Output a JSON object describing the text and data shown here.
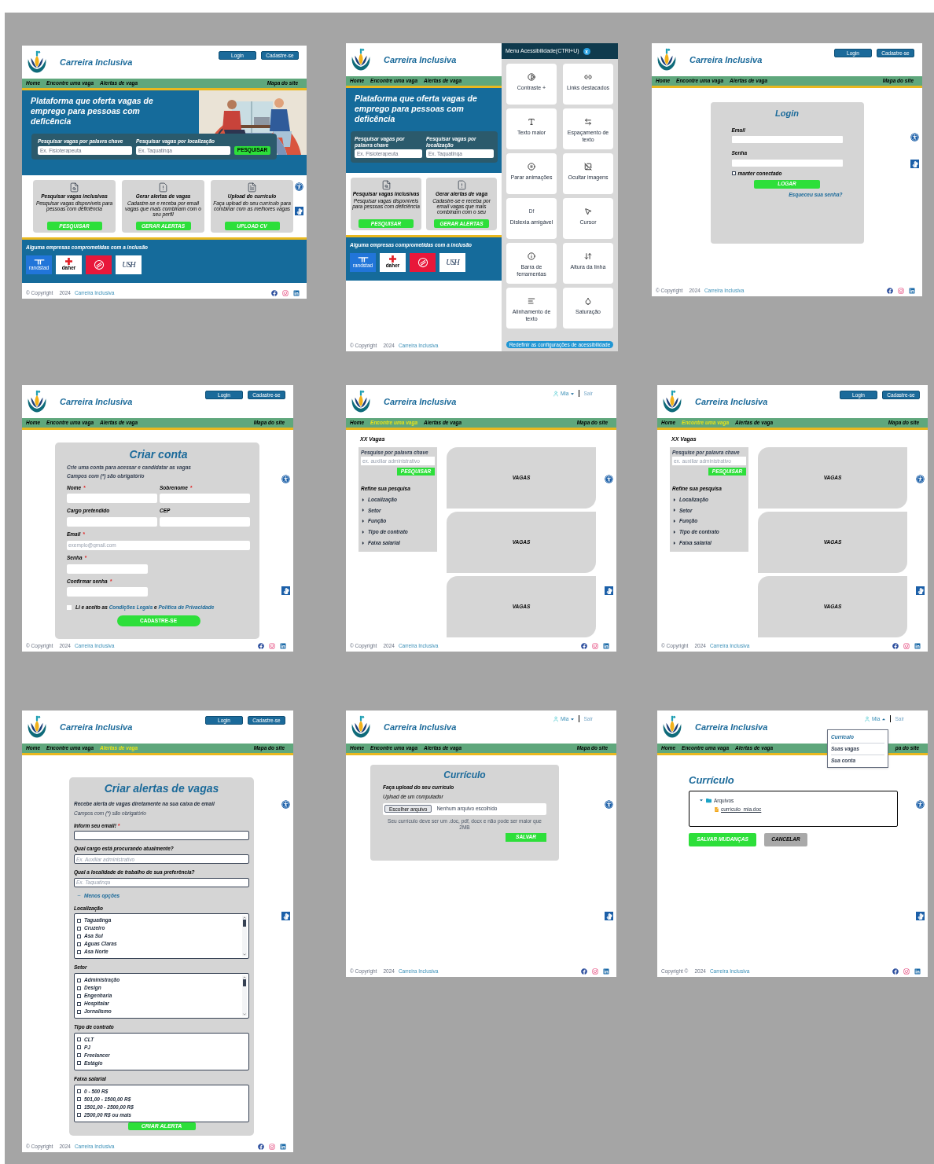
{
  "frames": [
    {
      "kind": "home",
      "header": {
        "title": "Carreira Inclusiva",
        "buttons": [
          "Login",
          "Cadastre-se"
        ]
      },
      "nav": {
        "items": [
          {
            "label": "Home",
            "selected": false
          },
          {
            "label": "Encontre uma vaga",
            "selected": false
          },
          {
            "label": "Alertas de vaga",
            "selected": false
          }
        ],
        "site_map": "Mapa do site"
      },
      "hero": {
        "title": "Plataforma que oferta vagas de emprego para pessoas com deficência",
        "picture": true,
        "search": {
          "fields": [
            {
              "label": "Pesquisar vagas por palavra chave",
              "placeholder": "Ex. Fisioterapeuta"
            },
            {
              "label": "Pesquisar vagas por localização",
              "placeholder": "Ex. Taguatinga"
            }
          ],
          "button": "PESQUISAR"
        }
      },
      "cards": [
        {
          "kind": "search",
          "title": "Pesquisar vagas inclusivas",
          "text": "Pesquisar vagas disponíveis para pessoas com deficiência",
          "button": "PESQUISAR"
        },
        {
          "kind": "alerts",
          "title": "Gerar alertas de vagas",
          "text": "Cadastre-se e receba por email vagas que mais combinam com o seu perfil",
          "button": "GERAR ALERTAS"
        },
        {
          "kind": "upload",
          "title": "Upload do currículo",
          "text": "Faça upload do seu currículo para combinar com as melhores vagas",
          "button": "UPLOAD CV"
        }
      ],
      "partners": {
        "title": "Alguma empresas comprometidas com a inclusão",
        "logos": [
          {
            "kind": "randstad",
            "label": "randstad"
          },
          {
            "kind": "daher",
            "label": "daher"
          },
          {
            "kind": "e-mark"
          },
          {
            "kind": "monogram",
            "label": "USH"
          }
        ]
      },
      "side_widgets": true,
      "footer": {
        "copyright": "© Copyright",
        "year": "2024",
        "brand": "Carreira Inclusiva",
        "socials": true
      }
    },
    {
      "kind": "home",
      "header": {
        "title": "Carreira Inclusiva"
      },
      "nav": {
        "items": [
          {
            "label": "Home",
            "selected": false
          },
          {
            "label": "Encontre uma vaga",
            "selected": false
          },
          {
            "label": "Alertas de vaga",
            "selected": false
          }
        ]
      },
      "hero": {
        "title": "Plataforma que oferta vagas de emprego para pessoas com deficência",
        "search": {
          "fields": [
            {
              "label": "Pesquisar vagas por palavra chave",
              "placeholder": "Ex. Fisioterapeuta"
            },
            {
              "label": "Pesquisar vagas por localização",
              "placeholder": "Ex. Taguatinga"
            }
          ]
        }
      },
      "cards": [
        {
          "kind": "search",
          "title": "Pesquisar vagas inclusivas",
          "text": "Pesquisar vagas disponíveis para pessoas com deficiência",
          "button": "PESQUISAR"
        },
        {
          "kind": "alerts",
          "title": "Gerar alertas de vaga",
          "text": "Cadastre-se e receba por email vagas que mais combinam com o seu",
          "button": "GERAR ALERTAS"
        }
      ],
      "partners": {
        "title": "Alguma empresas comprometidas com a inclusão",
        "logos": [
          {
            "kind": "randstad",
            "label": "randstad"
          },
          {
            "kind": "daher",
            "label": "daher"
          },
          {
            "kind": "e-mark"
          },
          {
            "kind": "monogram",
            "label": "USH"
          }
        ]
      },
      "accessibility_menu": {
        "title": "Menu Acessibilidade(CTRl+U)",
        "close": "x",
        "options": [
          {
            "kind": "contrast",
            "label": "Contraste +"
          },
          {
            "kind": "links",
            "label": "Links destacados"
          },
          {
            "kind": "text-size",
            "label": "Texto maior"
          },
          {
            "kind": "spacing",
            "label": "Espaçamento de texto"
          },
          {
            "kind": "animations",
            "label": "Parar animações"
          },
          {
            "kind": "images",
            "label": "Ocultar imagens"
          },
          {
            "kind": "dyslexia",
            "glyph": "Df",
            "label": "Dislexia amigável"
          },
          {
            "kind": "cursor",
            "label": "Cursor"
          },
          {
            "kind": "toolbar",
            "label": "Barra de ferramentas"
          },
          {
            "kind": "line-height",
            "label": "Altura da linha"
          },
          {
            "kind": "align",
            "label": "Alinhamento de texto"
          },
          {
            "kind": "saturation",
            "label": "Saturação"
          }
        ],
        "reset": "Redefinir as configurações de acessibilidade"
      },
      "footer": {
        "copyright": "© Copyright",
        "year": "2024",
        "brand": "Carreira Inclusiva"
      }
    },
    {
      "kind": "login",
      "header": {
        "title": "Carreira Inclusiva",
        "buttons": [
          "Login",
          "Cadastre-se"
        ]
      },
      "nav": {
        "items": [
          {
            "label": "Home",
            "selected": false
          },
          {
            "label": "Encontre uma vaga",
            "selected": false
          },
          {
            "label": "Alertas de vaga",
            "selected": false
          }
        ],
        "site_map": "Mapa do site"
      },
      "card": {
        "title": "Login",
        "fields": [
          {
            "label": "Email"
          },
          {
            "label": "Senha"
          }
        ],
        "remember": {
          "label": "manter conectado",
          "checked": false
        },
        "button": "LOGAR",
        "forgot": "Esqueceu sua senha?"
      },
      "side_widgets": true,
      "footer": {
        "copyright": "© Copyright",
        "year": "2024",
        "brand": "Carreira Inclusiva",
        "socials": true
      }
    },
    {
      "kind": "signup",
      "header": {
        "title": "Carreira Inclusiva",
        "buttons": [
          "Login",
          "Cadastre-se"
        ]
      },
      "nav": {
        "items": [
          {
            "label": "Home",
            "selected": false
          },
          {
            "label": "Encontre uma vaga",
            "selected": false
          },
          {
            "label": "Alertas de vaga",
            "selected": false
          }
        ],
        "site_map": "Mapa do site"
      },
      "form": {
        "title": "Criar conta",
        "subtitle": "Crie uma conta para acessar e candidatar as vagas",
        "note": "Campos com (*) são obrigatório",
        "rows": [
          [
            {
              "kind": "text",
              "label": "Nome",
              "mark": "*"
            },
            {
              "kind": "text",
              "label": "Sobrenome",
              "mark": "*"
            }
          ],
          [
            {
              "kind": "text",
              "label": "Cargo pretendido"
            },
            {
              "kind": "text",
              "label": "CEP"
            }
          ],
          [
            {
              "kind": "email",
              "label": "Email",
              "mark": "*",
              "placeholder": "exemplo@gmail.com"
            }
          ],
          [
            {
              "kind": "password",
              "label": "Senha",
              "mark": "*"
            }
          ],
          [
            {
              "kind": "password",
              "label": "Confirmar senha",
              "mark": "*"
            }
          ]
        ],
        "terms": {
          "checked": false,
          "text": "Li e aceito as",
          "links": [
            "Condições Legais",
            "Política de Privacidade"
          ],
          "joiner": "e"
        },
        "button": "CADASTRE-SE"
      },
      "side_widgets": true,
      "footer": {
        "copyright": "© Copyright",
        "year": "2024",
        "brand": "Carreira Inclusiva",
        "socials": true
      }
    },
    {
      "kind": "jobs",
      "header": {
        "title": "Carreira Inclusiva",
        "user": {
          "name": "Mia",
          "menu_open": false
        },
        "logout": "Sair"
      },
      "nav": {
        "items": [
          {
            "label": "Home",
            "selected": false
          },
          {
            "label": "Encontre uma vaga",
            "selected": true
          },
          {
            "label": "Alertas de vaga",
            "selected": false
          }
        ],
        "site_map": "Mapa do site"
      },
      "count_title": "XX Vagas",
      "search": {
        "label": "Pesquise por palavra chave",
        "placeholder": "ex. auxiliar administrativo",
        "button": "PESQUISAR"
      },
      "refine": {
        "title": "Refine sua pesquisa",
        "filters": [
          {
            "label": "Localização",
            "expanded": false
          },
          {
            "label": "Setor",
            "expanded": false
          },
          {
            "label": "Função",
            "expanded": false
          },
          {
            "label": "Tipo de contrato",
            "expanded": false
          },
          {
            "label": "Faixa salarial",
            "expanded": false
          }
        ]
      },
      "results": [
        "VAGAS",
        "VAGAS",
        "VAGAS"
      ],
      "side_widgets": true,
      "footer": {
        "copyright": "© Copyright",
        "year": "2024",
        "brand": "Carreira Inclusiva",
        "socials": true
      }
    },
    {
      "kind": "jobs",
      "header": {
        "title": "Carreira Inclusiva",
        "buttons": [
          "Login",
          "Cadastre-se"
        ]
      },
      "nav": {
        "items": [
          {
            "label": "Home",
            "selected": false
          },
          {
            "label": "Encontre uma vaga",
            "selected": true
          },
          {
            "label": "Alertas de vaga",
            "selected": false
          }
        ],
        "site_map": "Mapa do site"
      },
      "count_title": "XX Vagas",
      "search": {
        "label": "Pesquise por palavra chave",
        "placeholder": "ex. auxiliar administrativo",
        "button": "PESQUISAR"
      },
      "refine": {
        "title": "Refine sua pesquisa",
        "filters": [
          {
            "label": "Localização",
            "expanded": false
          },
          {
            "label": "Setor",
            "expanded": false
          },
          {
            "label": "Função",
            "expanded": false
          },
          {
            "label": "Tipo de contrato",
            "expanded": false
          },
          {
            "label": "Faixa salarial",
            "expanded": false
          }
        ]
      },
      "results": [
        "VAGAS",
        "VAGAS",
        "VAGAS"
      ],
      "side_widgets": true,
      "footer": {
        "copyright": "© Copyright",
        "year": "2024",
        "brand": "Carreira Inclusiva",
        "socials": true
      }
    },
    {
      "kind": "alerts",
      "header": {
        "title": "Carreira Inclusiva",
        "buttons": [
          "Login",
          "Cadastre-se"
        ]
      },
      "nav": {
        "items": [
          {
            "label": "Home",
            "selected": false
          },
          {
            "label": "Encontre uma vaga",
            "selected": false
          },
          {
            "label": "Alertas de vaga",
            "selected": true
          }
        ],
        "site_map": "Mapa do site"
      },
      "title": "Criar alertas de vagas",
      "subtitle": "Recebe alerta de vagas diretamente na sua caixa de email",
      "note": "Campos com (*) são obrigatório",
      "questions": [
        {
          "label": "Inform seu email!",
          "mark": "*"
        },
        {
          "label": "Qual cargo está procurando atualmente?",
          "placeholder": "Ex. Auxiliar administrativo"
        },
        {
          "label": "Qual a localidade de trabalho de sua preferência?",
          "placeholder": "Ex. Taguatinga"
        }
      ],
      "toggle": "Menos opções",
      "groups": [
        {
          "title": "Localização",
          "scroll": true,
          "options": [
            {
              "label": "Taguatinga",
              "checked": false
            },
            {
              "label": "Cruzeiro",
              "checked": false
            },
            {
              "label": "Asa Sul",
              "checked": false
            },
            {
              "label": "Aguas Claras",
              "checked": false
            },
            {
              "label": "Asa Norte",
              "checked": false
            }
          ]
        },
        {
          "title": "Setor",
          "scroll": true,
          "options": [
            {
              "label": "Administração",
              "checked": false
            },
            {
              "label": "Design",
              "checked": false
            },
            {
              "label": "Engenharia",
              "checked": false
            },
            {
              "label": "Hospitalar",
              "checked": false
            },
            {
              "label": "Jornalismo",
              "checked": false
            }
          ]
        },
        {
          "title": "Tipo de contrato",
          "scroll": false,
          "options": [
            {
              "label": "CLT",
              "checked": false
            },
            {
              "label": "PJ",
              "checked": false
            },
            {
              "label": "Freelancer",
              "checked": false
            },
            {
              "label": "Estágio",
              "checked": false
            }
          ]
        },
        {
          "title": "Faixa salarial",
          "scroll": false,
          "options": [
            {
              "label": "0 - 500 R$",
              "checked": false
            },
            {
              "label": "501,00 - 1500,00 R$",
              "checked": false
            },
            {
              "label": "1501,00 - 2500,00 R$",
              "checked": false
            },
            {
              "label": "2500,00 R$ ou mais",
              "checked": false
            }
          ]
        }
      ],
      "button": "CRIAR ALERTA",
      "side_widgets": true,
      "footer": {
        "copyright": "© Copyright",
        "year": "2024",
        "brand": "Carreira Inclusiva",
        "socials": true
      }
    },
    {
      "kind": "upload",
      "header": {
        "title": "Carreira Inclusiva",
        "user": {
          "name": "Mia",
          "menu_open": false
        },
        "logout": "Sair"
      },
      "nav": {
        "items": [
          {
            "label": "Home",
            "selected": false
          },
          {
            "label": "Encontre uma vaga",
            "selected": false
          },
          {
            "label": "Alertas de vaga",
            "selected": false
          }
        ],
        "site_map": "Mapa do site"
      },
      "title": "Currículo",
      "subtitle": "Faça upload do seu currículo",
      "source": "Upload de um computador",
      "file": {
        "button": "Escolher arquivo",
        "status": "Nenhum arquivo escolhido"
      },
      "hint": "Seu currículo deve ser um .doc, pdf, docx e não pode ser maior que 2MB",
      "button": "SALVAR",
      "side_widgets": true,
      "footer": {
        "copyright": "© Copyright",
        "year": "2024",
        "brand": "Carreira Inclusiva",
        "socials": true
      }
    },
    {
      "kind": "resume",
      "header": {
        "title": "Carreira Inclusiva",
        "user": {
          "name": "Mia",
          "menu_open": true,
          "menu": [
            {
              "label": "Currículo",
              "selected": true
            },
            {
              "label": "Suas vagas",
              "selected": false
            },
            {
              "label": "Sua conta",
              "selected": false
            }
          ]
        },
        "logout": "Sair"
      },
      "nav": {
        "items": [
          {
            "label": "Home",
            "selected": false
          },
          {
            "label": "Encontre uma vaga",
            "selected": false
          },
          {
            "label": "Alertas de vaga",
            "selected": false
          }
        ],
        "site_map": "pa do site"
      },
      "title": "Currículo",
      "tree": [
        {
          "label": "Arquivos",
          "expanded": true,
          "children": [
            {
              "label": "currículo_mia.doc"
            }
          ]
        }
      ],
      "actions": [
        {
          "kind": "primary",
          "label": "SALVAR MUDANÇAS"
        },
        {
          "kind": "secondary",
          "label": "CANCELAR"
        }
      ],
      "side_widgets": true,
      "footer": {
        "copyright": "Copyright ©",
        "year": "2024",
        "brand": "Carreira Inclusiva",
        "socials": true
      }
    }
  ]
}
